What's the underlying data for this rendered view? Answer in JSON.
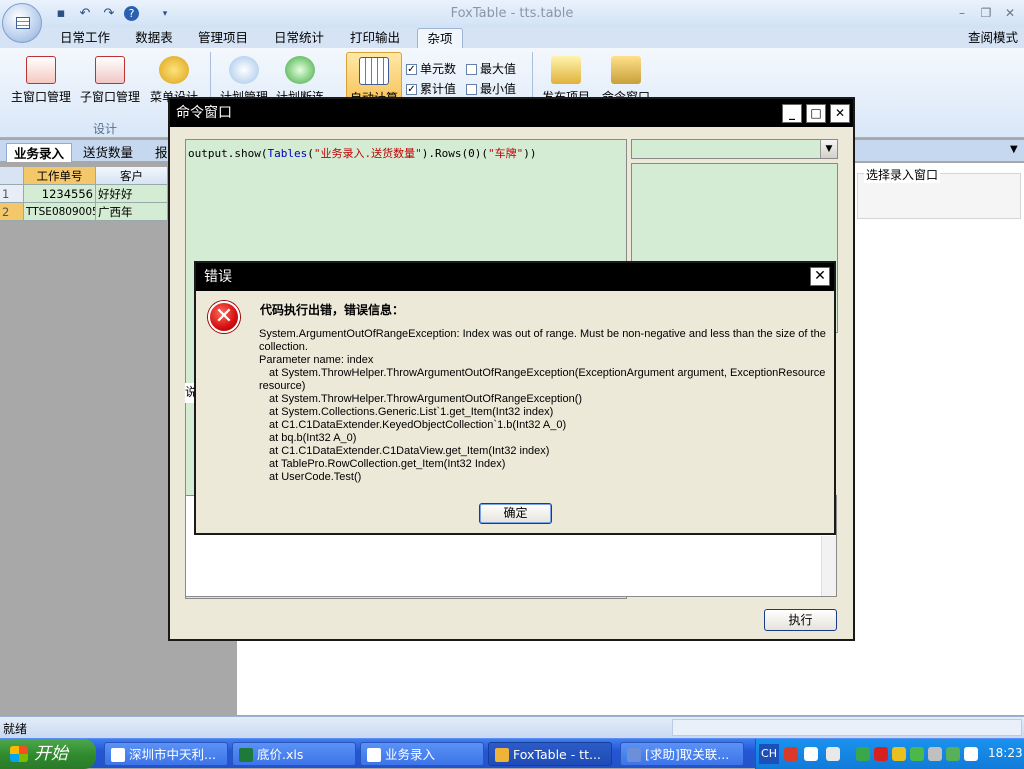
{
  "app": {
    "window_title": "FoxTable - tts.table",
    "mode_label": "查阅模式"
  },
  "quick_access": {
    "icons": [
      "save-icon",
      "undo-icon",
      "redo-icon",
      "help-icon",
      "dropdown-icon"
    ]
  },
  "ribbon_tabs": [
    "日常工作",
    "数据表",
    "管理项目",
    "日常统计",
    "打印输出",
    "杂项"
  ],
  "active_ribbon_tab": "杂项",
  "ribbon": {
    "buttons": [
      "主窗口管理",
      "子窗口管理",
      "菜单设计",
      "计划管理",
      "计划断连",
      "自动计算",
      "发布项目",
      "命令窗口"
    ],
    "group_label": "设计",
    "checks": [
      {
        "label": "单元数",
        "checked": true
      },
      {
        "label": "最大值",
        "checked": false
      },
      {
        "label": "累计值",
        "checked": true
      },
      {
        "label": "最小值",
        "checked": false
      }
    ]
  },
  "doc_tabs": [
    "业务录入",
    "送货数量",
    "报"
  ],
  "grid": {
    "headers": [
      "工作单号",
      "客户"
    ],
    "rows": [
      {
        "num": "1",
        "order": "1234556",
        "customer": "好好好"
      },
      {
        "num": "2",
        "order": "TTSE0809005",
        "customer": "广西年"
      }
    ]
  },
  "side_label": "选择录入窗口",
  "command_window": {
    "title": "命令窗口",
    "code_plain_1": "output.show(",
    "code_func": "Tables",
    "code_plain_2": "(",
    "code_str_1": "\"业务录入.送货数量\"",
    "code_plain_3": ").Rows(0)(",
    "code_str_2": "\"车牌\"",
    "code_plain_4": "))",
    "partial_label": "说",
    "execute_label": "执行"
  },
  "error_dialog": {
    "title": "错误",
    "heading": "代码执行出错，错误信息：",
    "message": "System.ArgumentOutOfRangeException: Index was out of range. Must be non-negative and less than the size of the collection.",
    "param_line": "Parameter name: index",
    "stack": [
      "at System.ThrowHelper.ThrowArgumentOutOfRangeException(ExceptionArgument argument, ExceptionResource resource)",
      "at System.ThrowHelper.ThrowArgumentOutOfRangeException()",
      "at System.Collections.Generic.List`1.get_Item(Int32 index)",
      "at C1.C1DataExtender.KeyedObjectCollection`1.b(Int32 A_0)",
      "at bq.b(Int32 A_0)",
      "at C1.C1DataExtender.C1DataView.get_Item(Int32 index)",
      "at TablePro.RowCollection.get_Item(Int32 Index)",
      "at UserCode.Test()"
    ],
    "ok_label": "确定"
  },
  "status": {
    "text": "就绪"
  },
  "taskbar": {
    "start_label": "开始",
    "buttons": [
      "深圳市中天利...",
      "底价.xls",
      "业务录入",
      "FoxTable - tt...",
      "[求助]取关联..."
    ],
    "active_index": 3,
    "lang": "CH",
    "clock": "18:23"
  },
  "colors": {
    "grid_green": "#d3ecd3",
    "title_black": "#000000",
    "error_red": "#d40f0f",
    "code_string": "#c00000",
    "code_func": "#0000c0"
  }
}
